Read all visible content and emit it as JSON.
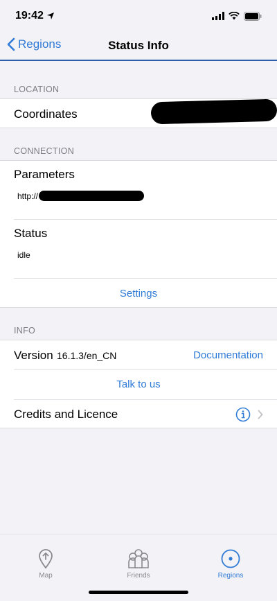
{
  "status_bar": {
    "time": "19:42"
  },
  "nav": {
    "back_label": "Regions",
    "title": "Status Info"
  },
  "location": {
    "header": "LOCATION",
    "coordinates_label": "Coordinates"
  },
  "connection": {
    "header": "CONNECTION",
    "parameters_label": "Parameters",
    "parameters_value": "http://",
    "status_label": "Status",
    "status_value": "idle",
    "settings_label": "Settings"
  },
  "info": {
    "header": "INFO",
    "version_label": "Version",
    "version_value": "16.1.3/en_CN",
    "documentation_label": "Documentation",
    "talk_label": "Talk to us",
    "credits_label": "Credits and Licence"
  },
  "tabbar": {
    "tabs": [
      {
        "label": "Map",
        "icon": "map-pin-icon",
        "active": false
      },
      {
        "label": "Friends",
        "icon": "friends-icon",
        "active": false
      },
      {
        "label": "Regions",
        "icon": "regions-icon",
        "active": true
      }
    ]
  },
  "colors": {
    "accent": "#2f7bd6",
    "nav_divider": "#2b5eab",
    "background": "#f2f2f7"
  },
  "icons": [
    "location-arrow-icon",
    "signal-icon",
    "wifi-icon",
    "battery-icon",
    "chevron-left-icon",
    "info-icon",
    "chevron-right-icon",
    "map-pin-icon",
    "friends-icon",
    "regions-icon"
  ]
}
